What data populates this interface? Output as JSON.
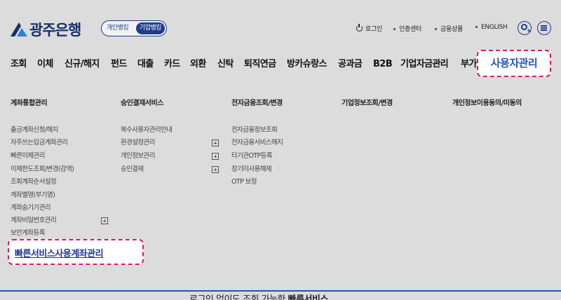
{
  "brand": {
    "name": "광주은행",
    "color": "#1e3d8c",
    "logo_icon": "kjbank-logo-icon"
  },
  "segment_toggle": {
    "personal": "개인뱅킹",
    "corporate": "기업뱅킹",
    "selected": "기업뱅킹"
  },
  "util_nav": {
    "login": "로그인",
    "certificate": "인증센터",
    "products": "금융상품",
    "english": "ENGLISH",
    "search_icon": "search-icon",
    "menu_icon": "hamburger-menu-icon"
  },
  "gnb": {
    "items": [
      "조회",
      "이체",
      "신규/해지",
      "펀드",
      "대출",
      "카드",
      "외환",
      "신탁",
      "퇴직연금",
      "방카슈랑스",
      "공과금",
      "B2B",
      "기업자금관리",
      "부가"
    ],
    "active": "사용자관리",
    "active_color": "#1d56c2",
    "highlight_border": "#d81b60"
  },
  "mega_menu": {
    "columns": [
      {
        "title": "계좌통합관리",
        "items": [
          {
            "label": "출금계좌신청/해지"
          },
          {
            "label": "자주쓰는입금계좌관리"
          },
          {
            "label": "빠른이체관리"
          },
          {
            "label": "이체한도조회/변경(감액)"
          },
          {
            "label": "조회계좌순서설정"
          },
          {
            "label": "계좌별명(부기명)"
          },
          {
            "label": "계좌숨기기관리"
          },
          {
            "label": "계좌비밀번호관리",
            "expandable": true
          },
          {
            "label": "보안계좌등록"
          }
        ],
        "highlighted": "빠른서비스사용계좌관리"
      },
      {
        "title": "승인결재서비스",
        "items": [
          {
            "label": "복수사용자관리안내"
          },
          {
            "label": "환경설정관리",
            "expandable": true
          },
          {
            "label": "개인정보관리",
            "expandable": true
          },
          {
            "label": "승인결재",
            "expandable": true
          }
        ]
      },
      {
        "title": "전자금융조회/변경",
        "items": [
          {
            "label": "전자금융정보조회"
          },
          {
            "label": "전자금융서비스해지"
          },
          {
            "label": "타기관OTP등록"
          },
          {
            "label": "장기미사용해제"
          },
          {
            "label": "OTP 보정"
          }
        ]
      },
      {
        "title": "기업정보조회/변경",
        "items": []
      },
      {
        "title": "개인정보이용동의/미동의",
        "items": []
      }
    ]
  },
  "footer": {
    "text_prefix": "로그인 없이도 조회 가능한",
    "text_bold": "빠른서비스",
    "divider_color": "#1f55b8"
  }
}
